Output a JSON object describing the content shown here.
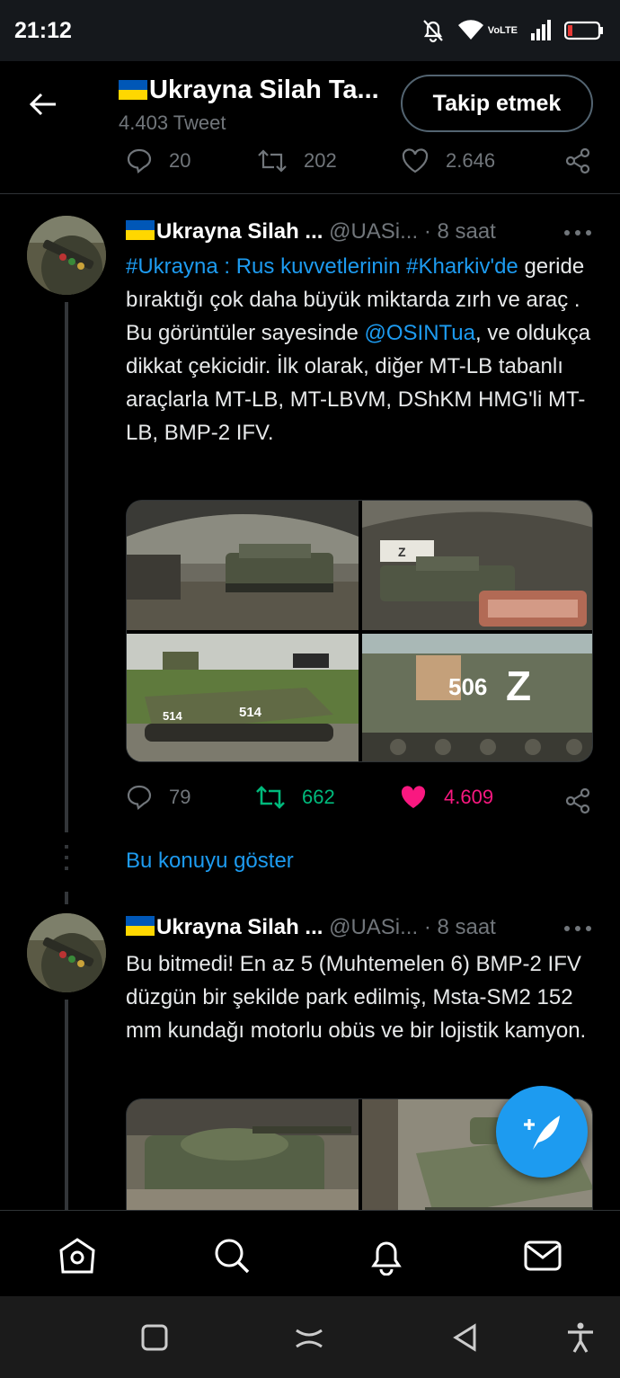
{
  "status_bar": {
    "time": "21:12",
    "icons": [
      "notifications-off-icon",
      "wifi-icon",
      "volte-icon",
      "signal-icon",
      "battery-low-icon"
    ],
    "volte_label": "VoLTE"
  },
  "header": {
    "title": "Ukrayna Silah Ta...",
    "subtitle": "4.403 Tweet",
    "follow_label": "Takip etmek",
    "prev_actions": {
      "replies": "20",
      "retweets": "202",
      "likes": "2.646"
    }
  },
  "tweets": [
    {
      "name": "Ukrayna Silah ...",
      "handle": "@UASi...",
      "time": "· 8 saat",
      "text_parts": [
        "#Ukrayna : Rus kuvvetlerinin #Kharkiv'de",
        " geride bıraktığı çok daha büyük miktarda zırh ve araç . Bu görüntüler sayesinde ",
        "@OSINTua",
        ", ve oldukça dikkat çekicidir. İlk olarak, diğer MT-LB tabanlı araçlarla MT-LB, MT-LBVM, DShKM HMG'li MT-LB, BMP-2 IFV."
      ],
      "replies": "79",
      "retweets": "662",
      "likes": "4.609",
      "images": [
        "hangar-vehicle-photo",
        "hangar-vehicle-z-photo",
        "mt-lb-514-photo",
        "vehicle-506-z-photo"
      ],
      "image_text": {
        "number_514": "514",
        "number_506": "506",
        "z_mark": "Z"
      }
    },
    {
      "name": "Ukrayna Silah ...",
      "handle": "@UASi...",
      "time": "· 8 saat",
      "text": "Bu bitmedi! En az 5 (Muhtemelen 6) BMP-2 IFV düzgün bir şekilde park edilmiş, Msta-SM2 152 mm kundağı motorlu obüs ve bir lojistik kamyon.",
      "images": [
        "destroyed-tank-photo",
        "bmp-2-photo"
      ]
    }
  ],
  "show_thread": "Bu konuyu göster",
  "colors": {
    "accent": "#1d9bf0",
    "retweet": "#00ba7c",
    "like": "#f91880",
    "muted": "#71767b"
  },
  "tabbar": [
    "home-icon",
    "search-icon",
    "notifications-icon",
    "messages-icon"
  ],
  "navbar": [
    "recents-icon",
    "home-gesture-icon",
    "back-icon",
    "accessibility-icon"
  ]
}
